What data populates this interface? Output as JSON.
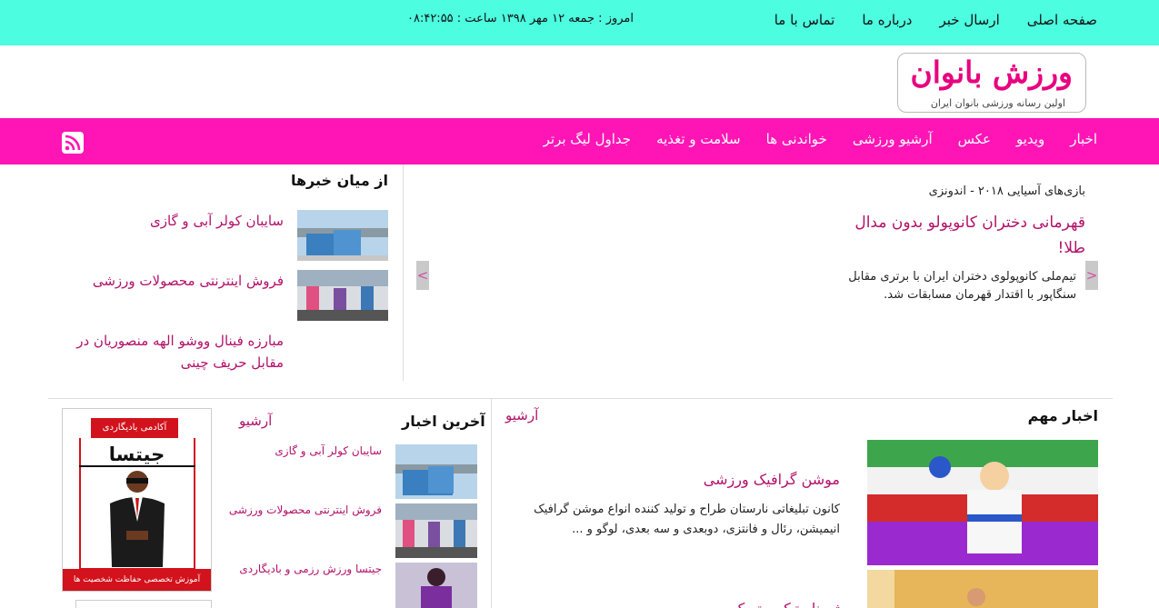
{
  "topbar": {
    "nav": [
      "صفحه اصلی",
      "ارسال خبر",
      "درباره ما",
      "تماس با ما"
    ],
    "datetime": "امروز : جمعه ۱۲ مهر ۱۳۹۸ ساعت : ۰۸:۴۲:۵۵"
  },
  "logo": {
    "title": "ورزش بانوان",
    "tagline": "اولین رسانه ورزشی بانوان ایران"
  },
  "mainnav": {
    "items": [
      "اخبار",
      "ویدیو",
      "عکس",
      "آرشیو ورزشی",
      "خواندنی ها",
      "سلامت و تغذیه",
      "جداول لیگ برتر"
    ]
  },
  "slider": {
    "category": "بازی‌های آسیایی ۲۰۱۸ - اندونزی",
    "title": "قهرمانی دختران کانوپولو بدون مدال طلا!",
    "description": "تیم‌ملی کانوپولوی دختران ایران با برتری مقابل سنگاپور با اقتدار قهرمان مسابقات شد.",
    "prev_icon": "chevron-left-icon",
    "next_icon": "chevron-right-icon"
  },
  "from_news": {
    "title": "از میان خبرها",
    "items": [
      {
        "text": "سایبان کولر آبی و گازی"
      },
      {
        "text": "فروش اینترنتی محصولات ورزشی"
      },
      {
        "text": "مبارزه فینال ووشو الهه منصوریان در مقابل حریف چینی"
      }
    ]
  },
  "important_news": {
    "title": "اخبار مهم",
    "archive": "آرشیو",
    "headline": "موشن گرافیک ورزشی",
    "description": "کانون تبلیغاتی نارستان طراح و تولید کننده انواع موشن گرافیک انیمیشن، رئال و فانتزی، دوبعدی و سه بعدی، لوگو و ...",
    "headline2": "ژیمناستیک ریتمیک"
  },
  "latest_news": {
    "title": "آخرین اخبار",
    "archive": "آرشیو",
    "items": [
      {
        "text": "سایبان کولر آبی و گازی"
      },
      {
        "text": "فروش اینترنتی محصولات ورزشی"
      },
      {
        "text": "جیتسا ورزش رزمی و بادیگاردی"
      }
    ]
  },
  "ad": {
    "badge": "آکادمی بادیگاردی",
    "brand": "جیتسا",
    "footer": "آموزش تخصصی حفاظت شخصیت ها"
  },
  "colors": {
    "topbar": "#4cfde0",
    "mainnav": "#ff15b5",
    "link": "#b3126a",
    "ad_red": "#d2121c"
  }
}
